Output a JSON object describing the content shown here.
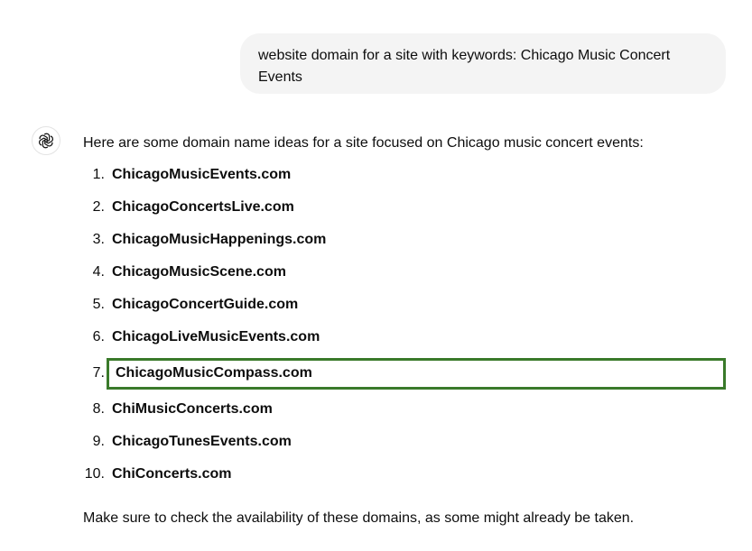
{
  "user_message": {
    "text": "website domain for a site with keywords: Chicago Music Concert Events",
    "line1": "website domain for a site with keywords: Chicago Music Concert",
    "line2": "Events"
  },
  "assistant": {
    "avatar_icon": "openai-logo-icon",
    "intro": "Here are some domain name ideas for a site focused on Chicago music concert events:",
    "items": [
      {
        "num": "1.",
        "text": "ChicagoMusicEvents.com"
      },
      {
        "num": "2.",
        "text": "ChicagoConcertsLive.com"
      },
      {
        "num": "3.",
        "text": "ChicagoMusicHappenings.com"
      },
      {
        "num": "4.",
        "text": "ChicagoMusicScene.com"
      },
      {
        "num": "5.",
        "text": "ChicagoConcertGuide.com"
      },
      {
        "num": "6.",
        "text": "ChicagoLiveMusicEvents.com"
      },
      {
        "num": "7.",
        "text": "ChicagoMusicCompass.com"
      },
      {
        "num": "8.",
        "text": "ChiMusicConcerts.com"
      },
      {
        "num": "9.",
        "text": "ChicagoTunesEvents.com"
      },
      {
        "num": "10.",
        "text": "ChiConcerts.com"
      }
    ],
    "highlighted_item_index": 6,
    "highlight_color": "#3a7a2a",
    "outro": "Make sure to check the availability of these domains, as some might already be taken."
  }
}
